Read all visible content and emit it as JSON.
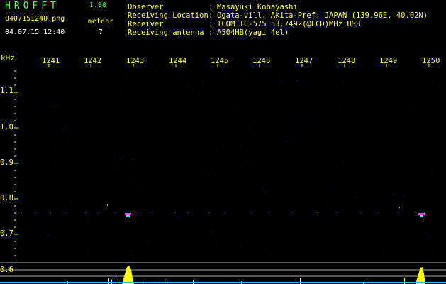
{
  "header": {
    "title": "HROFFT",
    "version": "1.00",
    "filename": "0407151240.png",
    "datetime": "04.07.15 12:40",
    "meteor_label": "meteor",
    "meteor_count": "7"
  },
  "info": [
    {
      "label": "Observer",
      "colon": ":",
      "value": "Masayuki Kobayashi"
    },
    {
      "label": "Receiving Location",
      "colon": ":",
      "value": "Ogata-vill. Akita-Pref. JAPAN (139.96E, 40.02N)"
    },
    {
      "label": "Receiver",
      "colon": ":",
      "value": "ICOM IC-575 53.7492(@LCD)MHz USB"
    },
    {
      "label": "Receiving antenna",
      "colon": ":",
      "value": "A504HB(yagi 4el)"
    }
  ],
  "spectrogram": {
    "unit_label": "kHz",
    "x_ticks": [
      "1241",
      "1242",
      "1243",
      "1244",
      "1245",
      "1246",
      "1247",
      "1248",
      "1249",
      "1250"
    ],
    "y_ticks": [
      "1.1",
      "1.0",
      "0.9",
      "0.8",
      "0.7",
      "0.6"
    ],
    "x_axis": "seconds (HH:MM:SS), minute 12:40",
    "y_axis_range_khz": [
      0.6,
      1.15
    ],
    "meteor_echoes": [
      {
        "time": "12:42:55",
        "freq_khz": 0.755
      },
      {
        "time": "12:49:45",
        "freq_khz": 0.755
      }
    ],
    "colors": {
      "background": "#000000",
      "noise": "#1a1a66",
      "tick_text": "#ffff55",
      "grid": "#aaaaaa",
      "echo": "#ff44ff",
      "level_bars": "#ffff00"
    }
  }
}
